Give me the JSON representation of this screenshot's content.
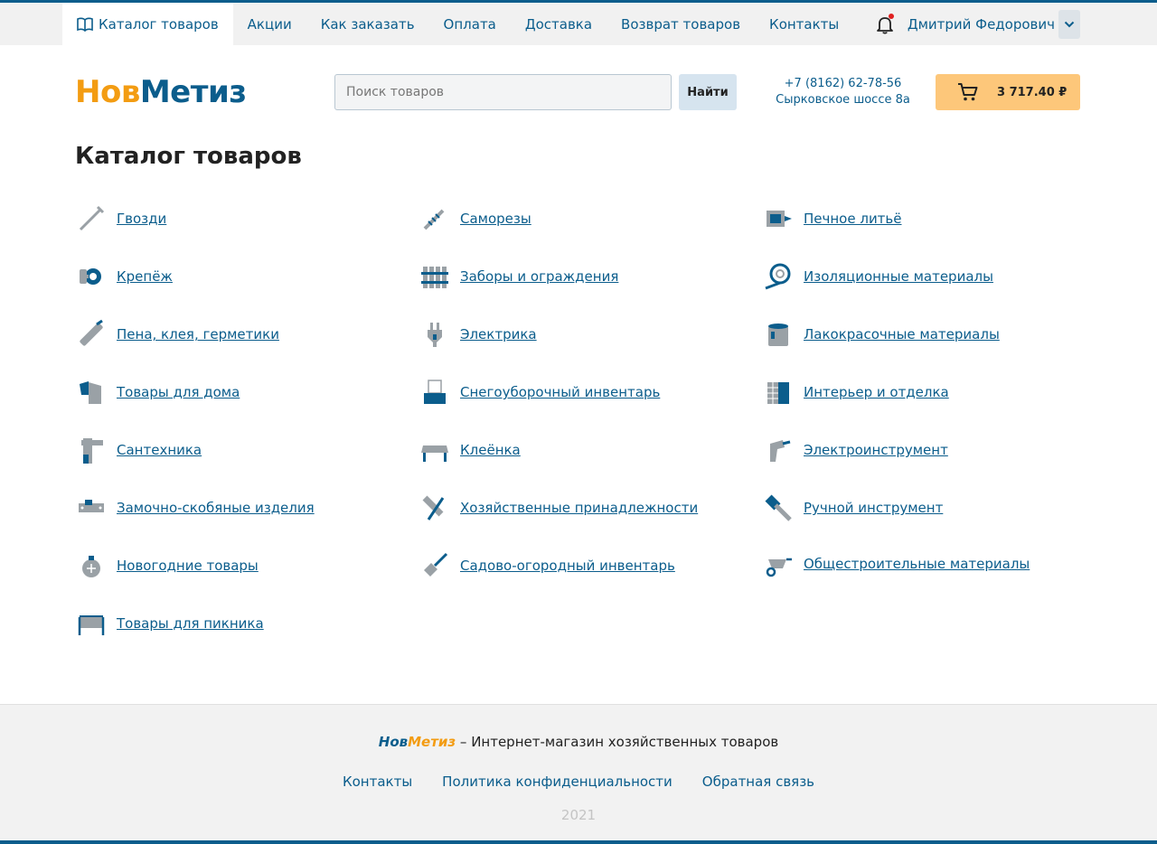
{
  "topnav": {
    "items": [
      {
        "label": "Каталог товаров"
      },
      {
        "label": "Акции"
      },
      {
        "label": "Как заказать"
      },
      {
        "label": "Оплата"
      },
      {
        "label": "Доставка"
      },
      {
        "label": "Возврат товаров"
      },
      {
        "label": "Контакты"
      }
    ],
    "active_index": 0,
    "user_name": "Дмитрий Федорович",
    "has_notification": true
  },
  "header": {
    "logo_part1": "Нов",
    "logo_part2": "Метиз",
    "search_placeholder": "Поиск товаров",
    "search_button": "Найти",
    "phone": "+7 (8162) 62-78-56",
    "address": "Сырковское шоссе 8а",
    "cart_total": "3 717.40 ₽"
  },
  "page_title": "Каталог товаров",
  "catalog": {
    "columns": [
      [
        {
          "label": "Гвозди",
          "icon": "nail-icon"
        },
        {
          "label": "Крепёж",
          "icon": "fastener-icon"
        },
        {
          "label": "Пена, клея, герметики",
          "icon": "sealant-icon"
        },
        {
          "label": "Товары для дома",
          "icon": "home-goods-icon"
        },
        {
          "label": "Сантехника",
          "icon": "faucet-icon"
        },
        {
          "label": "Замочно-скобяные изделия",
          "icon": "latch-icon"
        },
        {
          "label": "Новогодние товары",
          "icon": "ornament-icon"
        },
        {
          "label": "Товары для пикника",
          "icon": "grill-icon"
        }
      ],
      [
        {
          "label": "Саморезы",
          "icon": "screw-icon"
        },
        {
          "label": "Заборы и ограждения",
          "icon": "fence-icon"
        },
        {
          "label": "Электрика",
          "icon": "plug-icon"
        },
        {
          "label": "Снегоуборочный инвентарь",
          "icon": "snow-shovel-icon"
        },
        {
          "label": "Клеёнка",
          "icon": "table-cloth-icon"
        },
        {
          "label": "Хозяйственные принадлежности",
          "icon": "broom-icon"
        },
        {
          "label": "Садово-огородный инвентарь",
          "icon": "garden-shovel-icon"
        }
      ],
      [
        {
          "label": "Печное литьё",
          "icon": "stove-casting-icon"
        },
        {
          "label": "Изоляционные материалы",
          "icon": "insulation-roll-icon"
        },
        {
          "label": "Лакокрасочные материалы",
          "icon": "paint-can-icon"
        },
        {
          "label": "Интерьер и отделка",
          "icon": "interior-tile-icon"
        },
        {
          "label": "Электроинструмент",
          "icon": "drill-icon"
        },
        {
          "label": "Ручной инструмент",
          "icon": "hammer-icon"
        },
        {
          "label": "Общестроительные материалы",
          "icon": "wheelbarrow-icon"
        }
      ]
    ]
  },
  "footer": {
    "brand_part1": "Нов",
    "brand_part2": "Метиз",
    "tagline": " – Интернет-магазин хозяйственных товаров",
    "links": [
      {
        "label": "Контакты"
      },
      {
        "label": "Политика конфиденциальности"
      },
      {
        "label": "Обратная связь"
      }
    ],
    "year": "2021"
  },
  "colors": {
    "brand_blue": "#0b5d8c",
    "brand_orange": "#f39c12",
    "cart_bg": "#fdc77a",
    "icon_gray": "#9aa1a6"
  }
}
